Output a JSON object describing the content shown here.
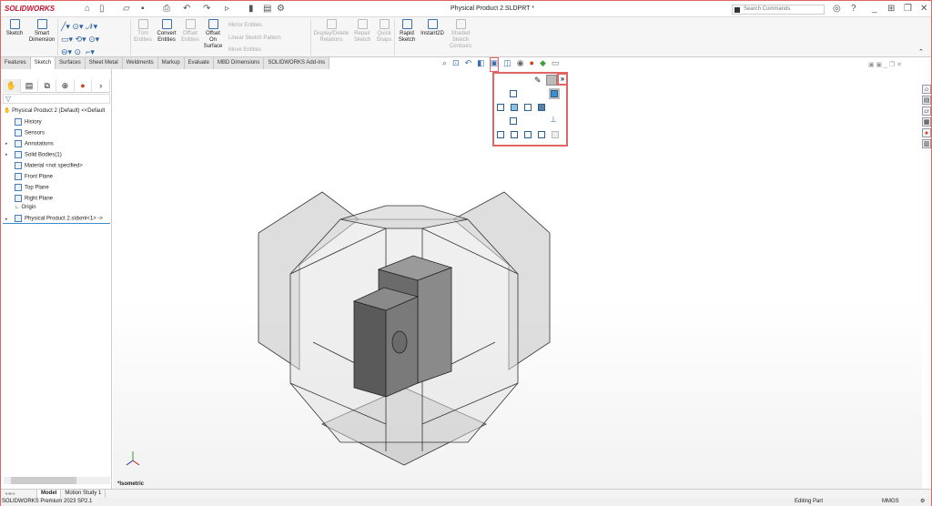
{
  "app": {
    "brand": "SOLIDWORKS",
    "document_title": "Physical Product 2.SLDPRT *",
    "search_placeholder": "Search Commands"
  },
  "command_manager": {
    "buttons": [
      {
        "label": "Sketch",
        "enabled": true
      },
      {
        "label": "Smart Dimension",
        "enabled": true
      },
      {
        "label": "Trim Entities",
        "enabled": false
      },
      {
        "label": "Convert Entities",
        "enabled": true
      },
      {
        "label": "Offset Entities",
        "enabled": false
      },
      {
        "label": "Offset On Surface",
        "enabled": true
      },
      {
        "label": "Display/Delete Relations",
        "enabled": false
      },
      {
        "label": "Repair Sketch",
        "enabled": false
      },
      {
        "label": "Quick Snaps",
        "enabled": false
      },
      {
        "label": "Rapid Sketch",
        "enabled": true
      },
      {
        "label": "Instant2D",
        "enabled": true
      },
      {
        "label": "Shaded Sketch Contours",
        "enabled": false
      }
    ],
    "small": [
      "Mirror Entities",
      "Linear Sketch Pattern",
      "Move Entities"
    ]
  },
  "tabs": [
    {
      "label": "Features"
    },
    {
      "label": "Sketch",
      "active": true
    },
    {
      "label": "Surfaces"
    },
    {
      "label": "Sheet Metal"
    },
    {
      "label": "Weldments"
    },
    {
      "label": "Markup"
    },
    {
      "label": "Evaluate"
    },
    {
      "label": "MBD Dimensions"
    },
    {
      "label": "SOLIDWORKS Add-Ins"
    }
  ],
  "tree": {
    "root": "Physical Product 2 (Default) <<Default",
    "items": [
      {
        "label": "History"
      },
      {
        "label": "Sensors"
      },
      {
        "label": "Annotations",
        "expandable": true
      },
      {
        "label": "Solid Bodies(1)",
        "expandable": true
      },
      {
        "label": "Material <not specified>"
      },
      {
        "label": "Front Plane"
      },
      {
        "label": "Top Plane"
      },
      {
        "label": "Right Plane"
      },
      {
        "label": "Origin"
      },
      {
        "label": "Physical Product 2.sldxml<1> ->",
        "expandable": true
      }
    ]
  },
  "viewport": {
    "view_name": "*Isometric",
    "flyout_more": "»"
  },
  "bottom_tabs": [
    {
      "label": "Model",
      "active": true
    },
    {
      "label": "Motion Study 1"
    }
  ],
  "status": {
    "product": "SOLIDWORKS Premium 2023 SP2.1",
    "mode": "Editing Part",
    "units": "MMGS"
  },
  "colors": {
    "brand": "#c8102e",
    "highlight": "#e06666",
    "accent": "#3a70b0"
  }
}
